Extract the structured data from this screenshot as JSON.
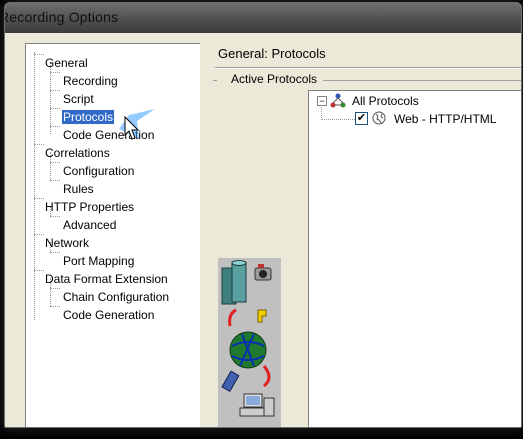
{
  "window": {
    "title": "Recording Options"
  },
  "tree": {
    "items": [
      {
        "label": "General",
        "level": 0
      },
      {
        "label": "Recording",
        "level": 1
      },
      {
        "label": "Script",
        "level": 1
      },
      {
        "label": "Protocols",
        "level": 1,
        "selected": true
      },
      {
        "label": "Code Generation",
        "level": 1
      },
      {
        "label": "Correlations",
        "level": 0
      },
      {
        "label": "Configuration",
        "level": 1
      },
      {
        "label": "Rules",
        "level": 1
      },
      {
        "label": "HTTP Properties",
        "level": 0
      },
      {
        "label": "Advanced",
        "level": 1
      },
      {
        "label": "Network",
        "level": 0
      },
      {
        "label": "Port Mapping",
        "level": 1
      },
      {
        "label": "Data Format Extension",
        "level": 0
      },
      {
        "label": "Chain Configuration",
        "level": 1
      },
      {
        "label": "Code Generation",
        "level": 1
      }
    ]
  },
  "panel": {
    "title": "General: Protocols",
    "group_label": "Active Protocols",
    "protocol_tree": {
      "expander": "−",
      "root_label": "All Protocols",
      "children": [
        {
          "label": "Web - HTTP/HTML",
          "checked": true,
          "check_mark": "✔"
        }
      ]
    }
  },
  "icons": {
    "all_protocols": "network-group-icon",
    "web_protocol": "globe-icon",
    "cursor": "mouse-pointer-icon",
    "art": "recording-workflow-illustration"
  },
  "colors": {
    "selection": "#316ac5",
    "window_background": "#ece9d8",
    "titlebar": "#4d4d4d"
  }
}
